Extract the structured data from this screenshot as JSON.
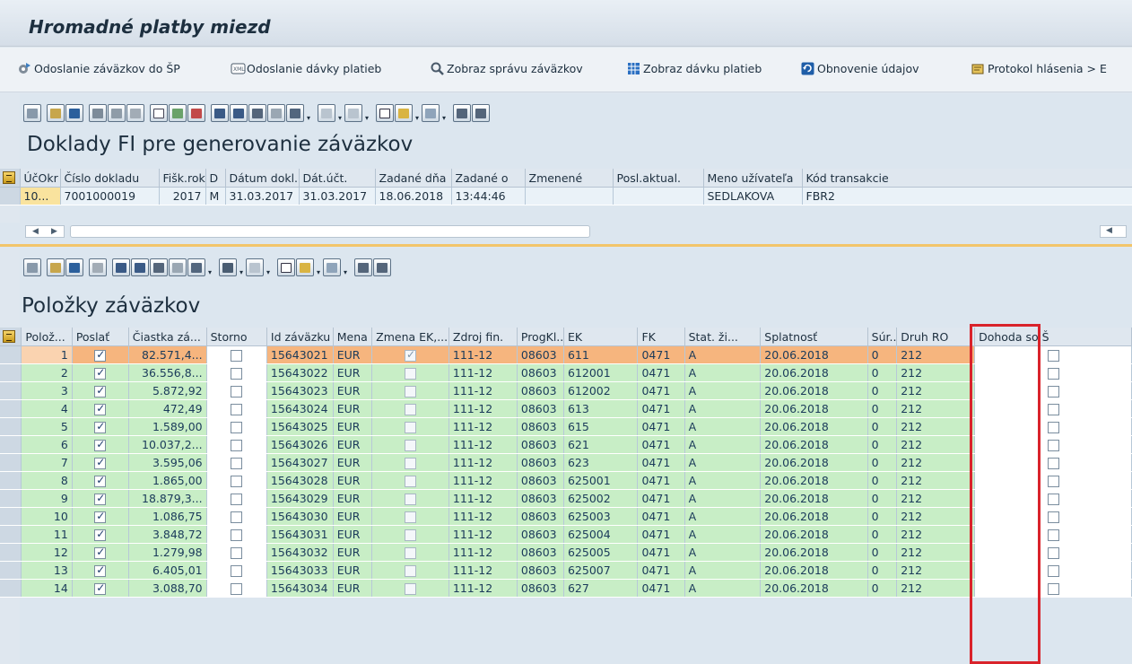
{
  "window": {
    "title": "Hromadné platby miezd"
  },
  "app_toolbar": [
    {
      "label": "Odoslanie záväzkov do ŠP",
      "icon": "send-icon"
    },
    {
      "label": "Odoslanie dávky platieb",
      "icon": "xml-icon"
    },
    {
      "label": "Zobraz správu záväzkov",
      "icon": "view-icon"
    },
    {
      "label": "Zobraz dávku platieb",
      "icon": "table-icon"
    },
    {
      "label": "Obnovenie údajov",
      "icon": "refresh-icon"
    },
    {
      "label": "Protokol hlásenia > E",
      "icon": "log-icon"
    }
  ],
  "colors": {
    "selected_row": "#f6b57e",
    "data_row": "#c8eec6",
    "highlight_box": "#d9232b"
  },
  "fi_section": {
    "title": "Doklady FI pre generovanie záväzkov",
    "columns": [
      "ÚčOkr",
      "Číslo dokladu",
      "Fišk.rok",
      "D",
      "Dátum dokl.",
      "Dát.účt.",
      "Zadané dňa",
      "Zadané o",
      "Zmenené",
      "Posl.aktual.",
      "Meno užívateľa",
      "Kód transakcie"
    ],
    "row": [
      "10...",
      "7001000019",
      "2017",
      "M",
      "31.03.2017",
      "31.03.2017",
      "18.06.2018",
      "13:44:46",
      "",
      "",
      "SEDLAKOVA",
      "FBR2"
    ]
  },
  "items_section": {
    "title": "Položky záväzkov",
    "columns": [
      "Polož...",
      "Poslať",
      "Čiastka zá...",
      "Storno",
      "Id záväzku",
      "Mena",
      "Zmena EK,...",
      "Zdroj fin.",
      "ProgKl...",
      "EK",
      "FK",
      "Stat. ži...",
      "Splatnosť",
      "Súr...",
      "Druh RO",
      "Dohoda so Š"
    ],
    "rows": [
      {
        "pos": "1",
        "amount": "82.571,4...",
        "id": "15643021",
        "cur": "EUR",
        "src": "111-12",
        "prog": "08603",
        "ek": "611",
        "fk": "0471",
        "stat": "A",
        "due": "20.06.2018",
        "sur": "0",
        "druh": "212",
        "selected": true
      },
      {
        "pos": "2",
        "amount": "36.556,8...",
        "id": "15643022",
        "cur": "EUR",
        "src": "111-12",
        "prog": "08603",
        "ek": "612001",
        "fk": "0471",
        "stat": "A",
        "due": "20.06.2018",
        "sur": "0",
        "druh": "212"
      },
      {
        "pos": "3",
        "amount": "5.872,92",
        "id": "15643023",
        "cur": "EUR",
        "src": "111-12",
        "prog": "08603",
        "ek": "612002",
        "fk": "0471",
        "stat": "A",
        "due": "20.06.2018",
        "sur": "0",
        "druh": "212"
      },
      {
        "pos": "4",
        "amount": "472,49",
        "id": "15643024",
        "cur": "EUR",
        "src": "111-12",
        "prog": "08603",
        "ek": "613",
        "fk": "0471",
        "stat": "A",
        "due": "20.06.2018",
        "sur": "0",
        "druh": "212"
      },
      {
        "pos": "5",
        "amount": "1.589,00",
        "id": "15643025",
        "cur": "EUR",
        "src": "111-12",
        "prog": "08603",
        "ek": "615",
        "fk": "0471",
        "stat": "A",
        "due": "20.06.2018",
        "sur": "0",
        "druh": "212"
      },
      {
        "pos": "6",
        "amount": "10.037,2...",
        "id": "15643026",
        "cur": "EUR",
        "src": "111-12",
        "prog": "08603",
        "ek": "621",
        "fk": "0471",
        "stat": "A",
        "due": "20.06.2018",
        "sur": "0",
        "druh": "212"
      },
      {
        "pos": "7",
        "amount": "3.595,06",
        "id": "15643027",
        "cur": "EUR",
        "src": "111-12",
        "prog": "08603",
        "ek": "623",
        "fk": "0471",
        "stat": "A",
        "due": "20.06.2018",
        "sur": "0",
        "druh": "212"
      },
      {
        "pos": "8",
        "amount": "1.865,00",
        "id": "15643028",
        "cur": "EUR",
        "src": "111-12",
        "prog": "08603",
        "ek": "625001",
        "fk": "0471",
        "stat": "A",
        "due": "20.06.2018",
        "sur": "0",
        "druh": "212"
      },
      {
        "pos": "9",
        "amount": "18.879,3...",
        "id": "15643029",
        "cur": "EUR",
        "src": "111-12",
        "prog": "08603",
        "ek": "625002",
        "fk": "0471",
        "stat": "A",
        "due": "20.06.2018",
        "sur": "0",
        "druh": "212"
      },
      {
        "pos": "10",
        "amount": "1.086,75",
        "id": "15643030",
        "cur": "EUR",
        "src": "111-12",
        "prog": "08603",
        "ek": "625003",
        "fk": "0471",
        "stat": "A",
        "due": "20.06.2018",
        "sur": "0",
        "druh": "212"
      },
      {
        "pos": "11",
        "amount": "3.848,72",
        "id": "15643031",
        "cur": "EUR",
        "src": "111-12",
        "prog": "08603",
        "ek": "625004",
        "fk": "0471",
        "stat": "A",
        "due": "20.06.2018",
        "sur": "0",
        "druh": "212"
      },
      {
        "pos": "12",
        "amount": "1.279,98",
        "id": "15643032",
        "cur": "EUR",
        "src": "111-12",
        "prog": "08603",
        "ek": "625005",
        "fk": "0471",
        "stat": "A",
        "due": "20.06.2018",
        "sur": "0",
        "druh": "212"
      },
      {
        "pos": "13",
        "amount": "6.405,01",
        "id": "15643033",
        "cur": "EUR",
        "src": "111-12",
        "prog": "08603",
        "ek": "625007",
        "fk": "0471",
        "stat": "A",
        "due": "20.06.2018",
        "sur": "0",
        "druh": "212"
      },
      {
        "pos": "14",
        "amount": "3.088,70",
        "id": "15643034",
        "cur": "EUR",
        "src": "111-12",
        "prog": "08603",
        "ek": "627",
        "fk": "0471",
        "stat": "A",
        "due": "20.06.2018",
        "sur": "0",
        "druh": "212"
      }
    ]
  }
}
